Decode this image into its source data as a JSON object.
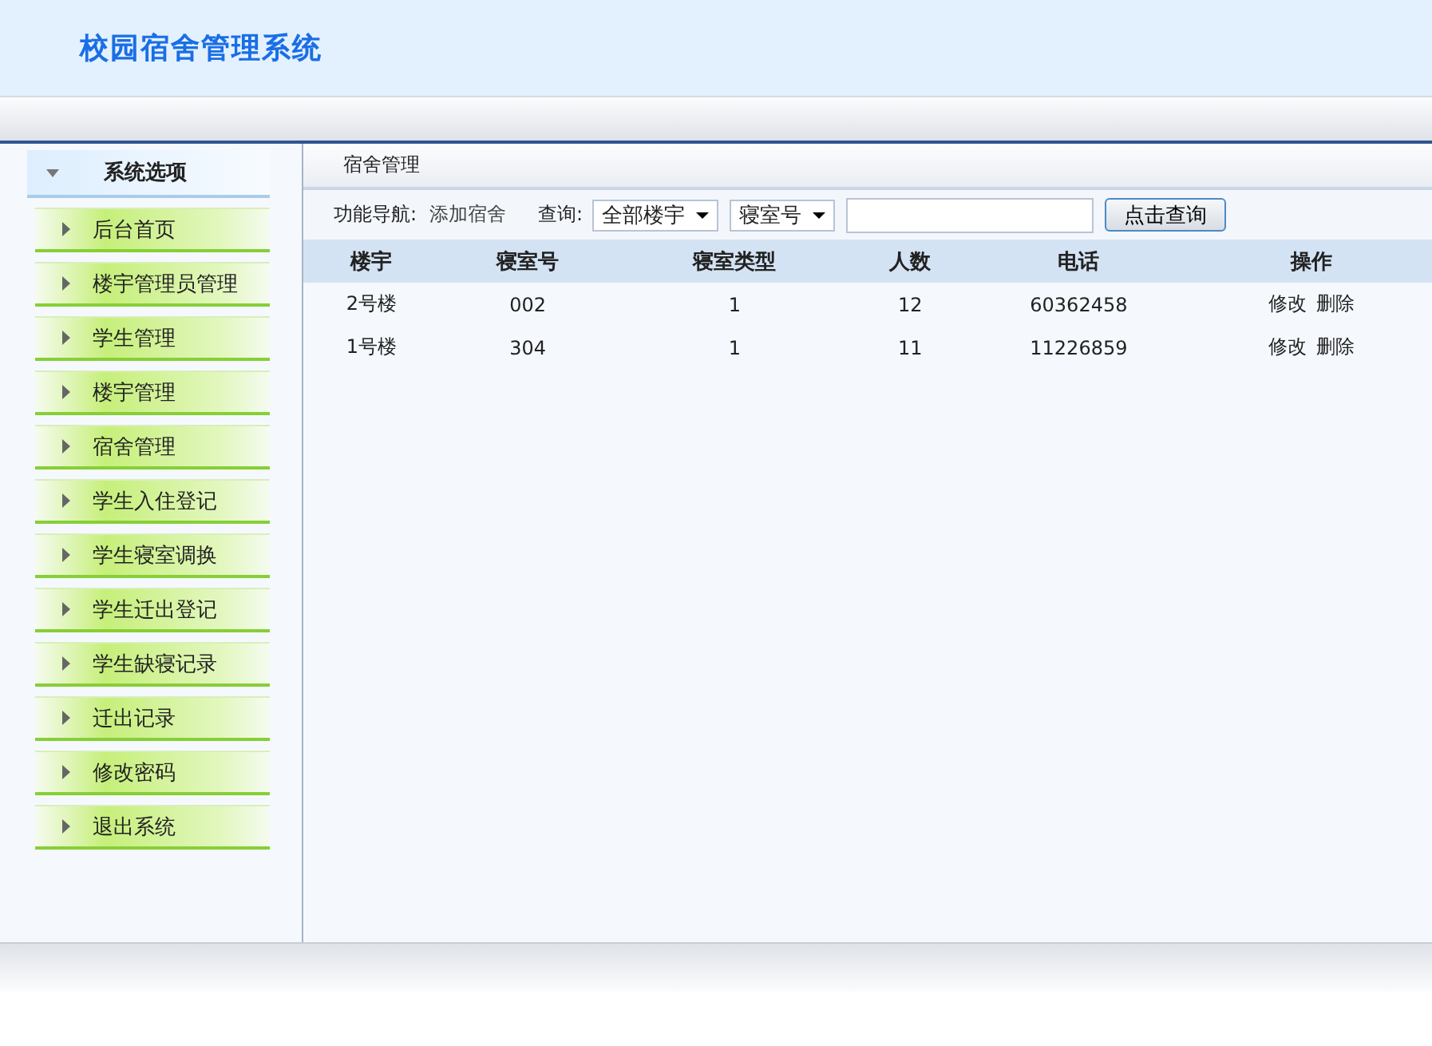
{
  "header": {
    "title": "校园宿舍管理系统"
  },
  "sidebar": {
    "title": "系统选项",
    "expanded": true,
    "items": [
      {
        "label": "后台首页"
      },
      {
        "label": "楼宇管理员管理"
      },
      {
        "label": "学生管理"
      },
      {
        "label": "楼宇管理"
      },
      {
        "label": "宿舍管理"
      },
      {
        "label": "学生入住登记"
      },
      {
        "label": "学生寝室调换"
      },
      {
        "label": "学生迁出登记"
      },
      {
        "label": "学生缺寝记录"
      },
      {
        "label": "迁出记录"
      },
      {
        "label": "修改密码"
      },
      {
        "label": "退出系统"
      }
    ]
  },
  "content": {
    "title": "宿舍管理",
    "toolbar": {
      "nav_label": "功能导航:",
      "nav_link": "添加宿舍",
      "query_label": "查询:",
      "building_select": "全部楼宇",
      "room_select": "寝室号",
      "search_button": "点击查询"
    },
    "table": {
      "columns": [
        "楼宇",
        "寝室号",
        "寝室类型",
        "人数",
        "电话",
        "操作"
      ],
      "rows": [
        {
          "cells": [
            "2号楼",
            "002",
            "1",
            "12",
            "60362458"
          ],
          "actions": [
            "修改",
            "删除"
          ]
        },
        {
          "cells": [
            "1号楼",
            "304",
            "1",
            "11",
            "11226859"
          ],
          "actions": [
            "修改",
            "删除"
          ]
        }
      ]
    }
  }
}
